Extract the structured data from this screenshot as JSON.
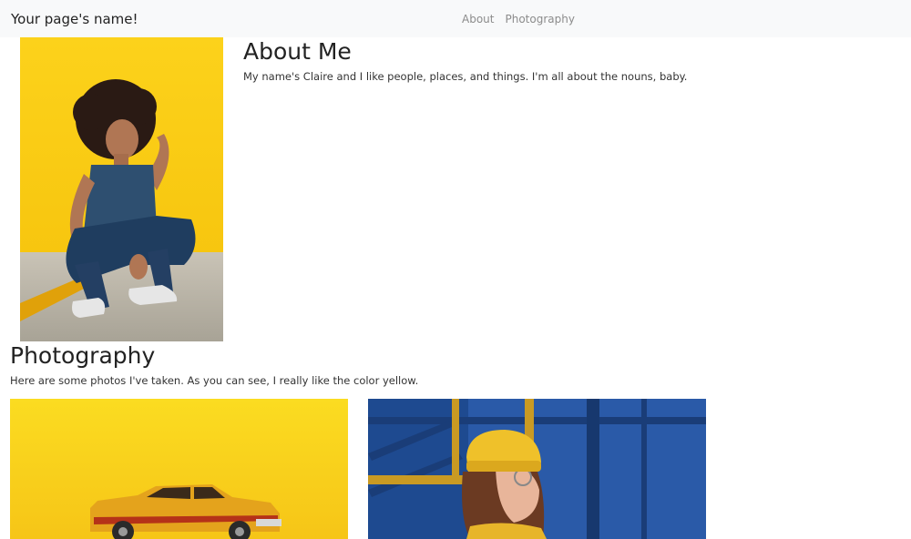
{
  "navbar": {
    "brand": "Your page's name!",
    "links": [
      "About",
      "Photography"
    ]
  },
  "about": {
    "title": "About Me",
    "text": "My name's Claire and I like people, places, and things. I'm all about the nouns, baby."
  },
  "photography": {
    "title": "Photography",
    "text": "Here are some photos I've taken. As you can see, I really like the color yellow."
  },
  "colors": {
    "navbar_bg": "#f8f9fa",
    "yellow": "#f9c80e",
    "blue": "#1f4f9c"
  }
}
